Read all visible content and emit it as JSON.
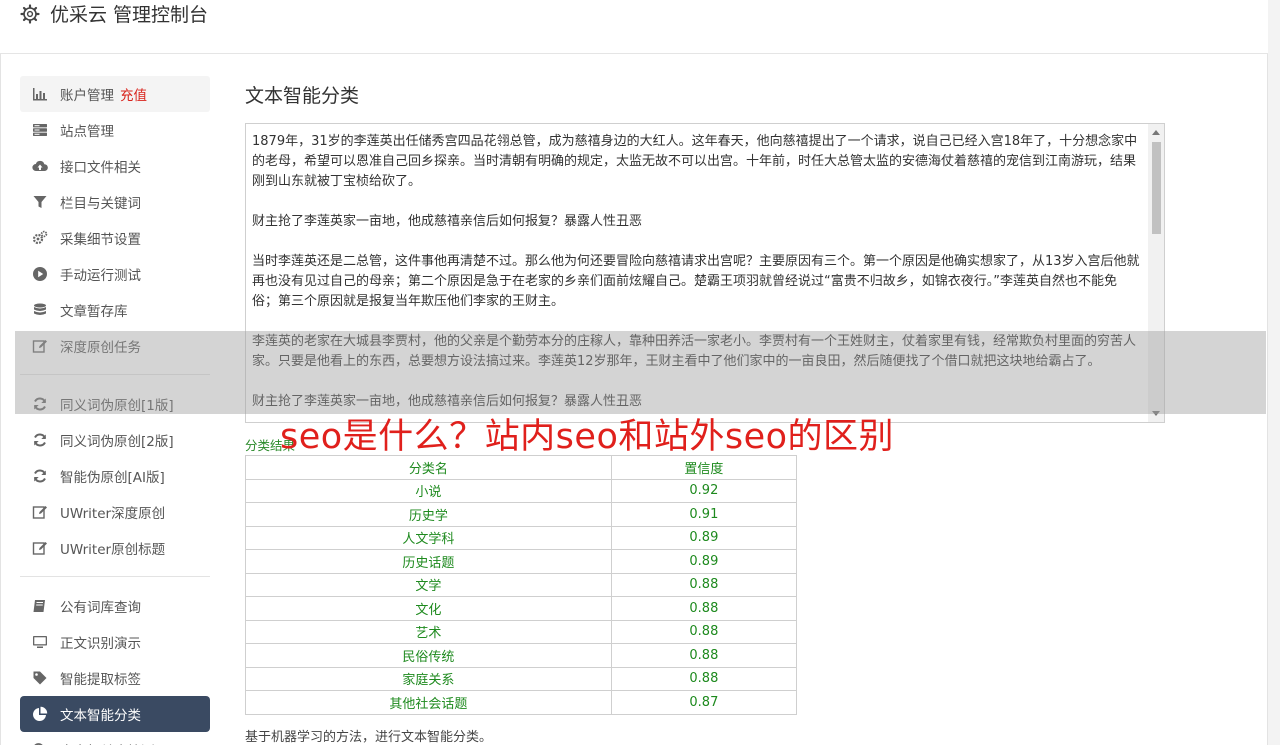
{
  "header": {
    "title": "优采云 管理控制台"
  },
  "sidebar": {
    "groups": [
      [
        {
          "label": "账户管理",
          "badge": "充值",
          "icon": "bar-chart-icon",
          "state": "highlight"
        },
        {
          "label": "站点管理",
          "icon": "server-icon"
        },
        {
          "label": "接口文件相关",
          "icon": "cloud-upload-icon"
        },
        {
          "label": "栏目与关键词",
          "icon": "filter-icon"
        },
        {
          "label": "采集细节设置",
          "icon": "gears-icon"
        },
        {
          "label": "手动运行测试",
          "icon": "play-circle-icon"
        },
        {
          "label": "文章暂存库",
          "icon": "database-icon"
        },
        {
          "label": "深度原创任务",
          "icon": "edit-icon"
        }
      ],
      [
        {
          "label": "同义词伪原创[1版]",
          "icon": "refresh-icon"
        },
        {
          "label": "同义词伪原创[2版]",
          "icon": "refresh-icon"
        },
        {
          "label": "智能伪原创[AI版]",
          "icon": "refresh-icon"
        },
        {
          "label": "UWriter深度原创",
          "icon": "edit-icon"
        },
        {
          "label": "UWriter原创标题",
          "icon": "edit-icon"
        }
      ],
      [
        {
          "label": "公有词库查询",
          "icon": "book-icon"
        },
        {
          "label": "正文识别演示",
          "icon": "monitor-icon"
        },
        {
          "label": "智能提取标签",
          "icon": "tag-icon"
        },
        {
          "label": "文本智能分类",
          "icon": "pie-chart-icon",
          "state": "active"
        },
        {
          "label": "内容相关度检测",
          "icon": "search-icon"
        }
      ]
    ]
  },
  "main": {
    "title": "文本智能分类",
    "text_paragraphs": [
      "1879年，31岁的李莲英出任储秀宫四品花翎总管，成为慈禧身边的大红人。这年春天，他向慈禧提出了一个请求，说自己已经入宫18年了，十分想念家中的老母，希望可以恩准自己回乡探亲。当时清朝有明确的规定，太监无故不可以出宫。十年前，时任大总管太监的安德海仗着慈禧的宠信到江南游玩，结果刚到山东就被丁宝桢给砍了。",
      "财主抢了李莲英家一亩地，他成慈禧亲信后如何报复？暴露人性丑恶",
      "当时李莲英还是二总管，这件事他再清楚不过。那么他为何还要冒险向慈禧请求出宫呢？主要原因有三个。第一个原因是他确实想家了，从13岁入宫后他就再也没有见过自己的母亲；第二个原因是急于在老家的乡亲们面前炫耀自己。楚霸王项羽就曾经说过“富贵不归故乡，如锦衣夜行。”李莲英自然也不能免俗；第三个原因就是报复当年欺压他们李家的王财主。",
      "李莲英的老家在大城县李贾村，他的父亲是个勤劳本分的庄稼人，靠种田养活一家老小。李贾村有一个王姓财主，仗着家里有钱，经常欺负村里面的穷苦人家。只要是他看上的东西，总要想方设法搞过来。李莲英12岁那年，王财主看中了他们家中的一亩良田，然后随便找了个借口就把这块地给霸占了。",
      "财主抢了李莲英家一亩地，他成慈禧亲信后如何报复？暴露人性丑恶"
    ],
    "result_label": "分类结果",
    "table": {
      "headers": [
        "分类名",
        "置信度"
      ],
      "rows": [
        [
          "小说",
          "0.92"
        ],
        [
          "历史学",
          "0.91"
        ],
        [
          "人文学科",
          "0.89"
        ],
        [
          "历史话题",
          "0.89"
        ],
        [
          "文学",
          "0.88"
        ],
        [
          "文化",
          "0.88"
        ],
        [
          "艺术",
          "0.88"
        ],
        [
          "民俗传统",
          "0.88"
        ],
        [
          "家庭关系",
          "0.88"
        ],
        [
          "其他社会话题",
          "0.87"
        ]
      ]
    },
    "footer_note": "基于机器学习的方法，进行文本智能分类。"
  },
  "watermark": "seo是什么？站内seo和站外seo的区别",
  "colors": {
    "active_nav": "#3a4a62",
    "badge": "#d9231c",
    "result_green": "#1e8a1e",
    "watermark": "#e0201c"
  }
}
